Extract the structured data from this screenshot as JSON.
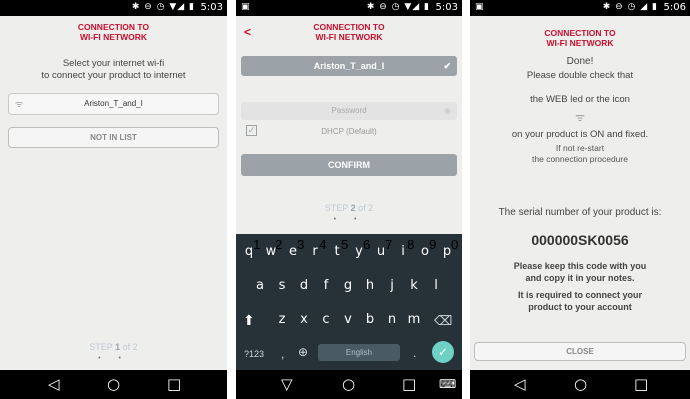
{
  "screen1": {
    "status_icons": "✱ ⊖ ◷ ▼◢ ▮",
    "time": "5:03",
    "title": [
      "CONNECTION TO",
      "WI-FI NETWORK"
    ],
    "instruction": [
      "Select your internet wi-fi",
      "to connect your product to internet"
    ],
    "network": "Ariston_T_and_I",
    "not_in_list": "NOT IN LIST",
    "step_prefix": "STEP ",
    "step_num": "1",
    "step_suffix": " of 2",
    "dots": "• •"
  },
  "screen2": {
    "status_left": "▣",
    "status_icons": "✱ ⊖ ◷ ▼◢ ▮",
    "time": "5:03",
    "back": "<",
    "title": [
      "CONNECTION TO",
      "WI-FI NETWORK"
    ],
    "ssid": "Ariston_T_and_I",
    "password_placeholder": "Password",
    "dhcp_label": "DHCP (Default)",
    "confirm": "CONFIRM",
    "step_prefix": "STEP ",
    "step_num": "2",
    "step_suffix": " of 2",
    "dots": "• •",
    "keyboard": {
      "row1": [
        "q",
        "w",
        "e",
        "r",
        "t",
        "y",
        "u",
        "i",
        "o",
        "p"
      ],
      "row1_nums": [
        "1",
        "2",
        "3",
        "4",
        "5",
        "6",
        "7",
        "8",
        "9",
        "0"
      ],
      "row2": [
        "a",
        "s",
        "d",
        "f",
        "g",
        "h",
        "j",
        "k",
        "l"
      ],
      "row3": [
        "z",
        "x",
        "c",
        "v",
        "b",
        "n",
        "m"
      ],
      "sym": "?123",
      "comma": ",",
      "space": "English",
      "period": "."
    }
  },
  "screen3": {
    "status_left": "▣",
    "status_icons": "✱ ⊖ ◷ ◢ ▮",
    "time": "5:06",
    "title": [
      "CONNECTION TO",
      "WI-FI NETWORK"
    ],
    "done": "Done!",
    "check": "Please double check that",
    "web_led": "the WEB led or the icon",
    "on_fixed": "on your product is ON and fixed.",
    "restart": [
      "If not re-start",
      "the connection procedure"
    ],
    "serial_label": "The serial number of your product is:",
    "serial": "000000SK0056",
    "keep": [
      "Please keep this code with you",
      "and copy it in your notes."
    ],
    "required": [
      "It is required to connect your",
      "product to your account"
    ],
    "close": "CLOSE"
  },
  "nav": {
    "back": "◁",
    "home": "○",
    "recent": "□",
    "keyboard": "⌨"
  },
  "colors": {
    "accent": "#c8102e",
    "confirm_gray": "#9ca3a8",
    "keyboard_bg": "#263238",
    "enter": "#6fd0c5"
  }
}
